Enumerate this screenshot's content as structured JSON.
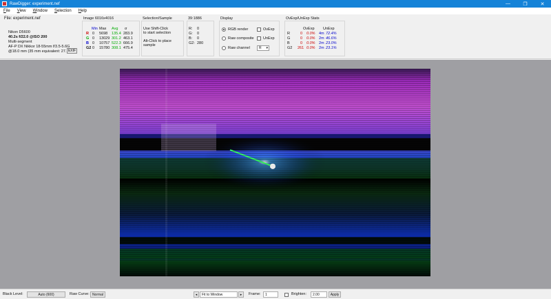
{
  "window": {
    "title": "RawDigger: experiment.nef",
    "min": "—",
    "max": "❐",
    "close": "✕"
  },
  "menu": [
    "File",
    "View",
    "Window",
    "Selection",
    "Help"
  ],
  "file": {
    "title": "File: experiment.nef",
    "camera": "Nikon D5600",
    "exposure": "40.2s f/22.0 @ISO 200",
    "metering": "Multi-segment",
    "lens": "AF-P DX Nikkor 18-55mm f/3.5-5.6G",
    "focal": "@18.0 mm (35 mm equivalent: 27.",
    "exif_button": "EXIF"
  },
  "image_stats": {
    "title": "Image 6016x4016",
    "headers": [
      "Min",
      "Max",
      "Avg",
      "σ"
    ],
    "rows": [
      {
        "ch": "R",
        "min": "0",
        "max": "5698",
        "avg": "135.4",
        "sd": "283.9"
      },
      {
        "ch": "G",
        "min": "0",
        "max": "13029",
        "avg": "301.2",
        "sd": "463.1"
      },
      {
        "ch": "B",
        "min": "0",
        "max": "10757",
        "avg": "522.3",
        "sd": "666.9"
      },
      {
        "ch": "G2",
        "min": "0",
        "max": "15780",
        "avg": "308.1",
        "sd": "475.4"
      }
    ]
  },
  "selection": {
    "title": "Selection/Sample",
    "line1": "Use Shift-Click",
    "line2": "to start selection",
    "line3": "Alt-Click to place",
    "line4": "sample"
  },
  "coords": {
    "title": "39:1886",
    "rows": [
      {
        "ch": "R:",
        "val": "0"
      },
      {
        "ch": "G:",
        "val": "0"
      },
      {
        "ch": "B:",
        "val": "0"
      },
      {
        "ch": "G2:",
        "val": "280"
      }
    ]
  },
  "display": {
    "title": "Display",
    "rgb": "RGB render",
    "composite": "Raw composite",
    "channel": "Raw channel",
    "ovexp": "OvExp",
    "unexp": "UnExp",
    "channel_value": "R"
  },
  "ovexp": {
    "title": "OvExp/UnExp Stats",
    "headers": [
      "OvExp",
      "UnExp"
    ],
    "rows": [
      {
        "ch": "R",
        "ov_n": "0",
        "ov_p": "0.0%",
        "un_n": "4m",
        "un_p": "72.4%"
      },
      {
        "ch": "G",
        "ov_n": "0",
        "ov_p": "0.0%",
        "un_n": "2m",
        "un_p": "46.6%"
      },
      {
        "ch": "B",
        "ov_n": "0",
        "ov_p": "0.0%",
        "un_n": "2m",
        "un_p": "23.0%"
      },
      {
        "ch": "G2",
        "ov_n": "261",
        "ov_p": "0.0%",
        "un_n": "2m",
        "un_p": "23.1%"
      }
    ]
  },
  "status": {
    "black_level_label": "Black Level:",
    "black_level_value": "Auto (600)",
    "raw_curve_label": "Raw Curve:",
    "raw_curve_value": "Normal",
    "fit": "Fit to Window",
    "prev_icon": "◂",
    "next_icon": "▸",
    "frame_label": "Frame:",
    "frame_value": "1",
    "brighten_label": "Brighten:",
    "brighten_value": "2.00",
    "apply": "Apply"
  },
  "colors": {
    "titlebar": "#1583d8",
    "viewport": "#9f9fa3"
  }
}
